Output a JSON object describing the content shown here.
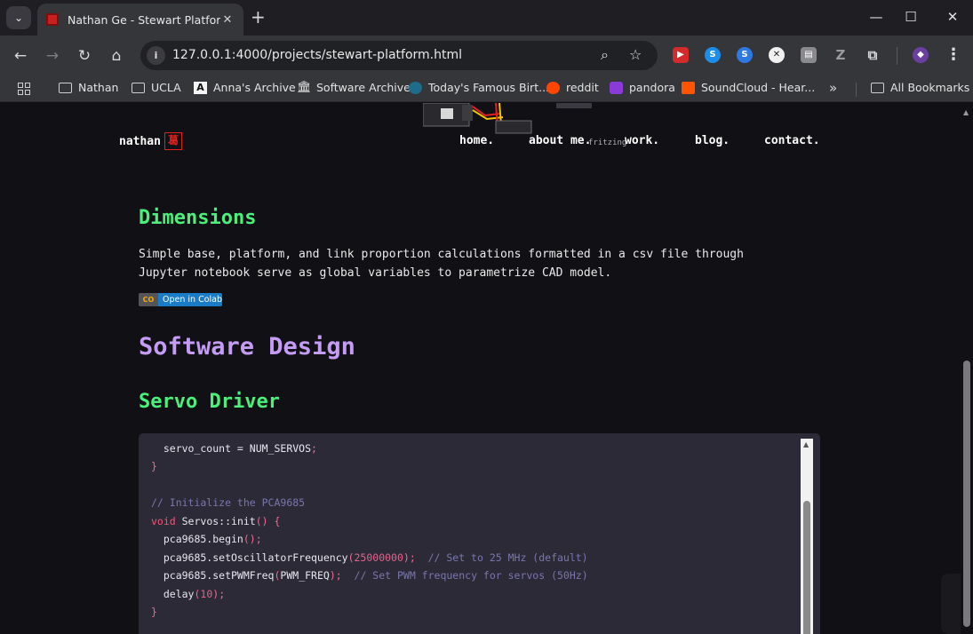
{
  "browser": {
    "tab_title": "Nathan Ge - Stewart Platform",
    "url": "127.0.0.1:4000/projects/stewart-platform.html",
    "bookmarks": [
      {
        "label": "Nathan",
        "icon": "folder-icon"
      },
      {
        "label": "UCLA",
        "icon": "folder-icon"
      },
      {
        "label": "Anna's Archive",
        "icon": "annas-archive-icon"
      },
      {
        "label": "Software Archive",
        "icon": "archive-icon"
      },
      {
        "label": "Today's Famous Birt...",
        "icon": "famous-birthdays-icon"
      },
      {
        "label": "reddit",
        "icon": "reddit-icon"
      },
      {
        "label": "pandora",
        "icon": "pandora-icon"
      },
      {
        "label": "SoundCloud - Hear...",
        "icon": "soundcloud-icon"
      },
      {
        "label": "All Bookmarks",
        "icon": "folder-icon"
      }
    ]
  },
  "site": {
    "logo_text": "nathan",
    "logo_seal": "葛",
    "nav": [
      "home.",
      "about me.",
      "work.",
      "blog.",
      "contact."
    ],
    "fritzing_label": "fritzing"
  },
  "content": {
    "dimensions_heading": "Dimensions",
    "dimensions_text": "Simple base, platform, and link proportion calculations formatted in a csv file through Jupyter notebook serve as global variables to parametrize CAD model.",
    "colab_badge": "Open in Colab",
    "colab_logo": "CO",
    "software_heading": "Software Design",
    "servo_heading": "Servo Driver"
  },
  "code": {
    "l1a": "  servo_count = NUM_SERVOS",
    "l1b": ";",
    "l2": "}",
    "l4": "// Initialize the PCA9685",
    "l5_kw": "void",
    "l5_name": " Servos::init",
    "l5_punc": "() {",
    "l6a": "  pca9685.begin",
    "l6b": "();",
    "l7a": "  pca9685.setOscillatorFrequency",
    "l7b": "(",
    "l7num": "25000000",
    "l7c": ");",
    "l7comment": "  // Set to 25 MHz (default)",
    "l8a": "  pca9685.setPWMFreq",
    "l8b": "(",
    "l8arg": "PWM_FREQ",
    "l8c": ");",
    "l8comment": "  // Set PWM frequency for servos (50Hz)",
    "l9a": "  delay",
    "l9b": "(",
    "l9num": "10",
    "l9c": ");",
    "l10": "}"
  }
}
